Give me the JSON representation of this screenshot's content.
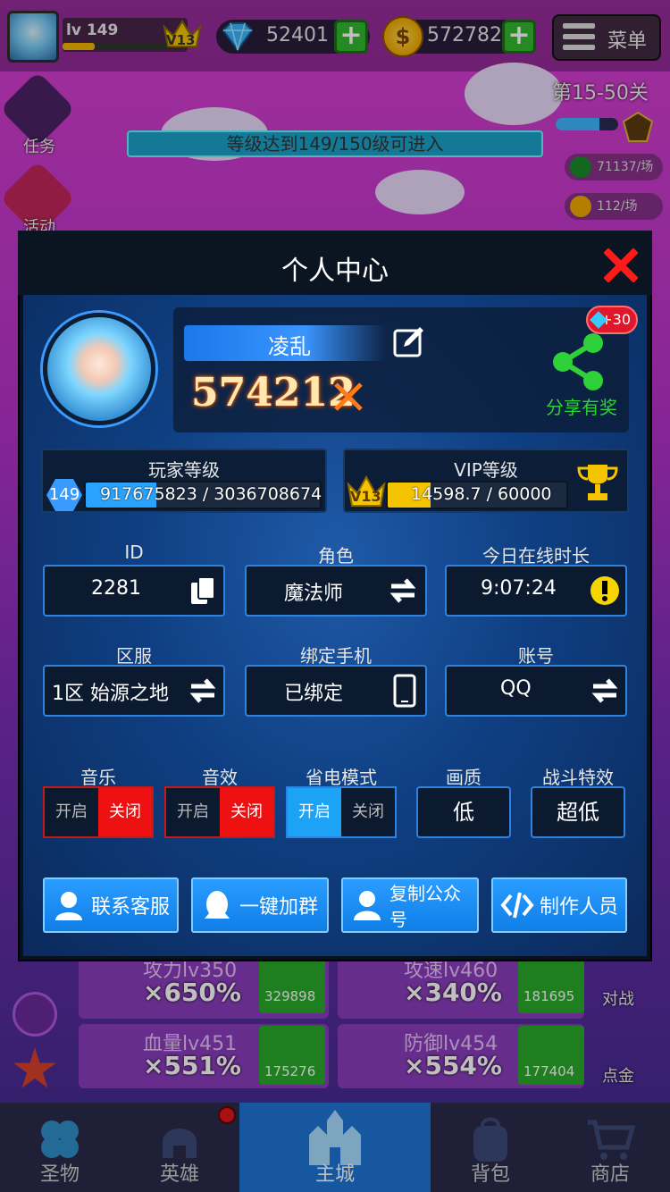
{
  "topbar": {
    "level_label": "lv 149",
    "vip_label": "V13",
    "gems": "52401",
    "coins": "572782",
    "menu_label": "菜单",
    "coin_glyph": "$"
  },
  "background": {
    "stage_title": "第15-50关",
    "banner_text": "等级达到149/150级可进入",
    "left_task_label": "任务",
    "left_event_label": "活动",
    "rate_1": "71137/场",
    "rate_2": "112/场"
  },
  "modal": {
    "title": "个人中心",
    "name": "凌乱",
    "power": "574212",
    "share_label": "分享有奖",
    "share_badge": "+30",
    "player_level": {
      "title": "玩家等级",
      "level": "149",
      "xp": "917675823 / 3036708674",
      "fill": 0.3
    },
    "vip_level": {
      "title": "VIP等级",
      "vip": "V13",
      "progress": "14598.7 / 60000",
      "fill": 0.24
    },
    "fields": {
      "id_label": "ID",
      "id_value": "2281",
      "role_label": "角色",
      "role_value": "魔法师",
      "online_label": "今日在线时长",
      "online_value": "9:07:24",
      "server_label": "区服",
      "server_value": "1区 始源之地",
      "phone_label": "绑定手机",
      "phone_value": "已绑定",
      "account_label": "账号",
      "account_value": "QQ"
    },
    "settings": {
      "music_label": "音乐",
      "sfx_label": "音效",
      "power_label": "省电模式",
      "quality_label": "画质",
      "combat_label": "战斗特效",
      "on_text": "开启",
      "off_text": "关闭",
      "quality_value": "低",
      "combat_value": "超低",
      "music_state": "off",
      "sfx_state": "off",
      "power_state": "on"
    },
    "actions": {
      "service": "联系客服",
      "group": "一键加群",
      "official": "复制公众号",
      "credits": "制作人员"
    }
  },
  "upgrades": [
    {
      "label": "攻力lv350",
      "pct": "×650%",
      "cost": "329898"
    },
    {
      "label": "攻速lv460",
      "pct": "×340%",
      "cost": "181695"
    },
    {
      "label": "血量lv451",
      "pct": "×551%",
      "cost": "175276"
    },
    {
      "label": "防御lv454",
      "pct": "×554%",
      "cost": "177404"
    }
  ],
  "side_right": {
    "battle": "对战",
    "gold": "点金"
  },
  "tabs": {
    "relic": "圣物",
    "hero": "英雄",
    "city": "主城",
    "bag": "背包",
    "shop": "商店"
  },
  "colors": {
    "accent_blue": "#2f83e0",
    "off_red": "#ee1111",
    "on_blue": "#1da3f6",
    "share_green": "#2fd13a"
  }
}
